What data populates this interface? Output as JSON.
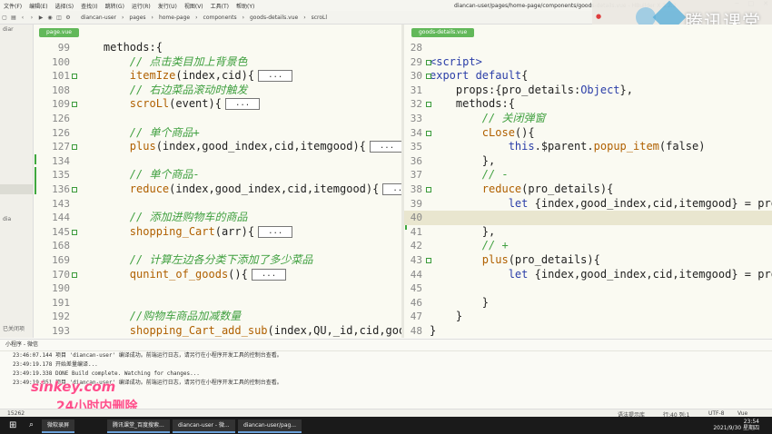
{
  "menubar": {
    "items": [
      "文件(F)",
      "编辑(E)",
      "选择(S)",
      "查找(I)",
      "跳转(G)",
      "运行(R)",
      "发行(U)",
      "视图(V)",
      "工具(T)",
      "帮助(Y)"
    ],
    "window_title": "diancan-user/pages/home-page/components/goods-details.vue - HBuilder X 3.2.3"
  },
  "toolbar": {
    "breadcrumb": [
      "diancan-user",
      "pages",
      "home-page",
      "components",
      "goods-details.vue",
      "scroLl"
    ]
  },
  "brand": {
    "text": "腾讯课堂"
  },
  "sidebar": {
    "rows": [
      "diar",
      "",
      "",
      "",
      "",
      "",
      "",
      "",
      "",
      "",
      "",
      "",
      "",
      "",
      "",
      "",
      "",
      "",
      "",
      "dia",
      "",
      "",
      "",
      "",
      "",
      "",
      "",
      "",
      "",
      "",
      "已关闭项"
    ]
  },
  "left_pane": {
    "tab": "page.vue",
    "lines": [
      {
        "n": "99",
        "indent": "    ",
        "parts": [
          {
            "t": "methods:{",
            "c": "pl"
          }
        ]
      },
      {
        "n": "100",
        "indent": "        ",
        "parts": [
          {
            "t": "// 点击类目加上背景色",
            "c": "cm"
          }
        ]
      },
      {
        "n": "101",
        "indent": "        ",
        "fold": true,
        "parts": [
          {
            "t": "itemIze",
            "c": "fn"
          },
          {
            "t": "(index,cid){",
            "c": "pl"
          }
        ],
        "ellipsis": "..."
      },
      {
        "n": "108",
        "indent": "        ",
        "parts": [
          {
            "t": "// 右边菜品滚动时触发",
            "c": "cm"
          }
        ]
      },
      {
        "n": "109",
        "indent": "        ",
        "fold": true,
        "parts": [
          {
            "t": "scroLl",
            "c": "fn"
          },
          {
            "t": "(event){",
            "c": "pl"
          }
        ],
        "ellipsis": "..."
      },
      {
        "n": "126",
        "indent": "",
        "parts": []
      },
      {
        "n": "126",
        "indent": "        ",
        "parts": [
          {
            "t": "// 单个商品+",
            "c": "cm"
          }
        ]
      },
      {
        "n": "127",
        "indent": "        ",
        "fold": true,
        "parts": [
          {
            "t": "plus",
            "c": "fn"
          },
          {
            "t": "(index,good_index,cid,itemgood){",
            "c": "pl"
          }
        ],
        "ellipsis": "..."
      },
      {
        "n": "134",
        "indent": "",
        "parts": []
      },
      {
        "n": "135",
        "indent": "        ",
        "parts": [
          {
            "t": "// 单个商品-",
            "c": "cm"
          }
        ]
      },
      {
        "n": "136",
        "indent": "        ",
        "fold": true,
        "parts": [
          {
            "t": "reduce",
            "c": "fn"
          },
          {
            "t": "(index,good_index,cid,itemgood){",
            "c": "pl"
          }
        ],
        "ellipsis": "..."
      },
      {
        "n": "143",
        "indent": "",
        "parts": []
      },
      {
        "n": "144",
        "indent": "        ",
        "parts": [
          {
            "t": "// 添加进购物车的商品",
            "c": "cm"
          }
        ]
      },
      {
        "n": "145",
        "indent": "        ",
        "fold": true,
        "parts": [
          {
            "t": "shopping_Cart",
            "c": "fn"
          },
          {
            "t": "(arr){",
            "c": "pl"
          }
        ],
        "ellipsis": "..."
      },
      {
        "n": "168",
        "indent": "",
        "parts": []
      },
      {
        "n": "169",
        "indent": "        ",
        "parts": [
          {
            "t": "// 计算左边各分类下添加了多少菜品",
            "c": "cm"
          }
        ]
      },
      {
        "n": "170",
        "indent": "        ",
        "fold": true,
        "parts": [
          {
            "t": "qunint_of_goods",
            "c": "fn"
          },
          {
            "t": "(){",
            "c": "pl"
          }
        ],
        "ellipsis": "..."
      },
      {
        "n": "190",
        "indent": "",
        "parts": []
      },
      {
        "n": "191",
        "indent": "",
        "parts": []
      },
      {
        "n": "192",
        "indent": "        ",
        "parts": [
          {
            "t": "//购物车商品加减数量",
            "c": "cm"
          }
        ]
      },
      {
        "n": "193",
        "indent": "        ",
        "parts": [
          {
            "t": "shopping_Cart_add_sub",
            "c": "fn"
          },
          {
            "t": "(index,QU,_id,cid,good_inde",
            "c": "pl"
          }
        ]
      }
    ]
  },
  "right_pane": {
    "tab": "goods-details.vue",
    "lines": [
      {
        "n": "28",
        "indent": "",
        "parts": []
      },
      {
        "n": "29",
        "indent": "",
        "fold": true,
        "parts": [
          {
            "t": "<script>",
            "c": "kw"
          }
        ]
      },
      {
        "n": "30",
        "indent": "",
        "fold": true,
        "parts": [
          {
            "t": "export default",
            "c": "kw"
          },
          {
            "t": "{",
            "c": "pl"
          }
        ]
      },
      {
        "n": "31",
        "indent": "    ",
        "parts": [
          {
            "t": "props:{pro_details:",
            "c": "pl"
          },
          {
            "t": "Object",
            "c": "kw"
          },
          {
            "t": "},",
            "c": "pl"
          }
        ]
      },
      {
        "n": "32",
        "indent": "    ",
        "fold": true,
        "parts": [
          {
            "t": "methods:{",
            "c": "pl"
          }
        ]
      },
      {
        "n": "33",
        "indent": "        ",
        "parts": [
          {
            "t": "// 关闭弹窗",
            "c": "cm"
          }
        ]
      },
      {
        "n": "34",
        "indent": "        ",
        "fold": true,
        "parts": [
          {
            "t": "cLose",
            "c": "fn"
          },
          {
            "t": "(){",
            "c": "pl"
          }
        ]
      },
      {
        "n": "35",
        "indent": "            ",
        "parts": [
          {
            "t": "this",
            "c": "kw"
          },
          {
            "t": ".$parent.",
            "c": "pl"
          },
          {
            "t": "popup_item",
            "c": "fn"
          },
          {
            "t": "(false)",
            "c": "pl"
          }
        ]
      },
      {
        "n": "36",
        "indent": "        ",
        "parts": [
          {
            "t": "},",
            "c": "pl"
          }
        ]
      },
      {
        "n": "37",
        "indent": "        ",
        "parts": [
          {
            "t": "// -",
            "c": "cm"
          }
        ]
      },
      {
        "n": "38",
        "indent": "        ",
        "fold": true,
        "parts": [
          {
            "t": "reduce",
            "c": "fn"
          },
          {
            "t": "(pro_details){",
            "c": "pl"
          }
        ]
      },
      {
        "n": "39",
        "indent": "            ",
        "parts": [
          {
            "t": "let",
            "c": "kw"
          },
          {
            "t": " {index,good_index,cid,itemgood} = pro_de",
            "c": "pl"
          }
        ]
      },
      {
        "n": "40",
        "indent": "",
        "hl": true,
        "parts": []
      },
      {
        "n": "41",
        "indent": "        ",
        "parts": [
          {
            "t": "},",
            "c": "pl"
          }
        ]
      },
      {
        "n": "42",
        "indent": "        ",
        "parts": [
          {
            "t": "// +",
            "c": "cm"
          }
        ]
      },
      {
        "n": "43",
        "indent": "        ",
        "fold": true,
        "parts": [
          {
            "t": "plus",
            "c": "fn"
          },
          {
            "t": "(pro_details){",
            "c": "pl"
          }
        ]
      },
      {
        "n": "44",
        "indent": "            ",
        "parts": [
          {
            "t": "let",
            "c": "kw"
          },
          {
            "t": " {index,good_index,cid,itemgood} = pro_de",
            "c": "pl"
          }
        ]
      },
      {
        "n": "45",
        "indent": "",
        "parts": []
      },
      {
        "n": "46",
        "indent": "        ",
        "parts": [
          {
            "t": "}",
            "c": "pl"
          }
        ]
      },
      {
        "n": "47",
        "indent": "    ",
        "parts": [
          {
            "t": "}",
            "c": "pl"
          }
        ]
      },
      {
        "n": "48",
        "indent": "",
        "parts": [
          {
            "t": "}",
            "c": "pl"
          }
        ]
      }
    ]
  },
  "console": {
    "header": "小程序 - 微信",
    "lines": [
      "23:46:07.144 项目 'diancan-user' 编译成功。前端运行日志，请另行在小程序开发工具的控制台查看。",
      "23:49:19.178 开始差量编译...",
      "23:49:19.338 DONE  Build complete. Watching for changes...",
      "23:49:19.351 项目 'diancan-user' 编译成功。前端运行日志，请另行在小程序开发工具的控制台查看。"
    ]
  },
  "watermark": {
    "line1": "sinkey.com",
    "line2": "24小时内删除"
  },
  "statusbar": {
    "left": "15262",
    "grammar": "语法提示库",
    "position": "行:40  列:1",
    "encoding": "UTF-8",
    "language": "Vue"
  },
  "taskbar": {
    "apps": [
      "微软录屏",
      "腾讯课堂_百度搜索...",
      "diancan-user - 微...",
      "diancan-user/pag..."
    ],
    "time": "23:54",
    "date": "2021/9/30 星期四"
  },
  "colors": {
    "accent": "#62b85a",
    "keyword": "#2b3ea8",
    "function": "#b06000",
    "comment": "#40a040",
    "watermark": "#ff4f8b"
  }
}
